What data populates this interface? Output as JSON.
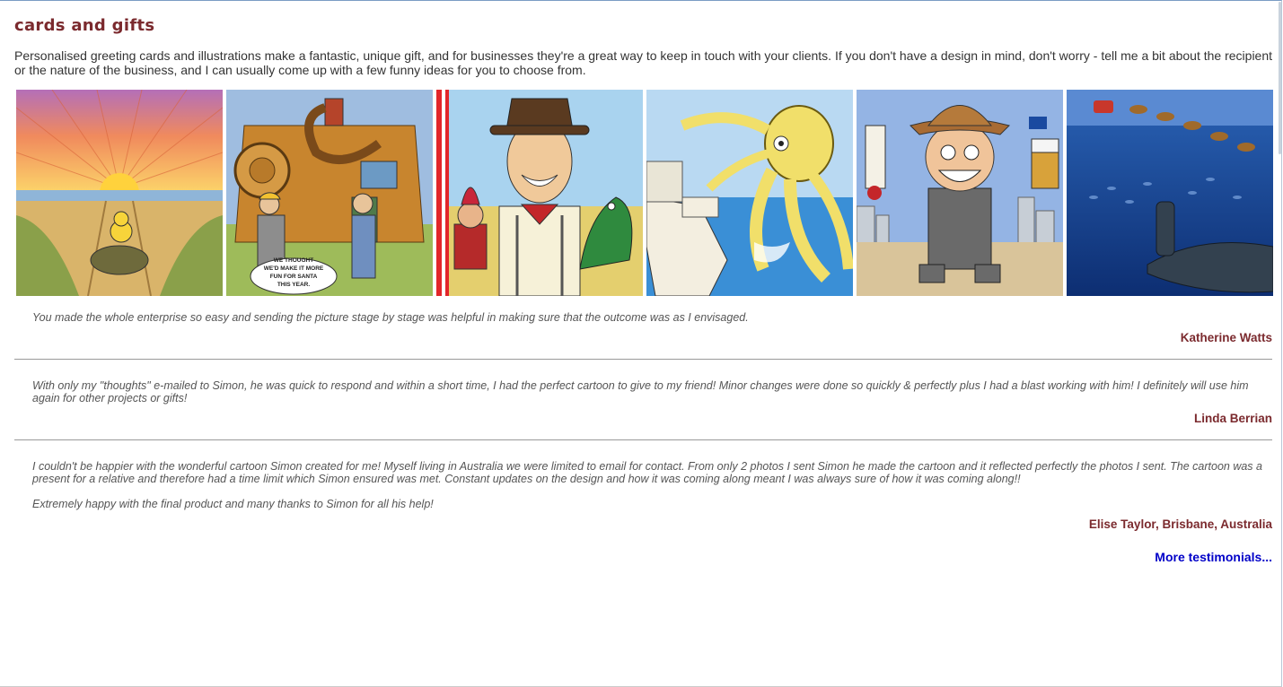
{
  "page": {
    "title": "cards and gifts",
    "intro": "Personalised greeting cards and illustrations make a fantastic, unique gift, and for businesses they're a great way to keep in touch with your clients. If you don't have a design in mind, don't worry - tell me a bit about the recipient or the nature of the business, and I can usually come up with a few funny ideas for you to choose from."
  },
  "gallery": [
    {
      "subject": "sunset-tortoise-chick-illustration"
    },
    {
      "subject": "wooden-house-builders-illustration",
      "speech": [
        "WE THOUGHT",
        "WE'D MAKE IT MORE",
        "FUN FOR SANTA",
        "THIS YEAR."
      ]
    },
    {
      "subject": "punch-and-judy-man-illustration"
    },
    {
      "subject": "octopus-cruise-ship-illustration"
    },
    {
      "subject": "cowboy-businessman-caricature"
    },
    {
      "subject": "santa-sleigh-submarine-illustration"
    }
  ],
  "testimonials": [
    {
      "paragraphs": [
        "You made the whole enterprise so easy and sending the picture stage by stage was helpful in making sure that the outcome was as I envisaged."
      ],
      "author": "Katherine Watts"
    },
    {
      "paragraphs": [
        "With only my \"thoughts\" e-mailed to Simon, he was quick to respond and within a short time, I had the perfect cartoon to give to my friend! Minor changes were done so quickly & perfectly plus I had a blast working with him! I definitely will use him again for other projects or gifts!"
      ],
      "author": "Linda Berrian"
    },
    {
      "paragraphs": [
        "I couldn't be happier with the wonderful cartoon Simon created for me! Myself living in Australia we were limited to email for contact. From only 2 photos I sent Simon he made the cartoon and it reflected perfectly the photos I sent. The cartoon was a present for a relative and therefore had a time limit which Simon ensured was met. Constant updates on the design and how it was coming along meant I was always sure of how it was coming along!!",
        "Extremely happy with the final product and many thanks to Simon for all his help!"
      ],
      "author": "Elise Taylor, Brisbane, Australia"
    }
  ],
  "more_link": "More testimonials...",
  "colors": {
    "heading": "#7b2a2e",
    "link": "#0000c8",
    "text": "#333333",
    "quote": "#555555"
  }
}
